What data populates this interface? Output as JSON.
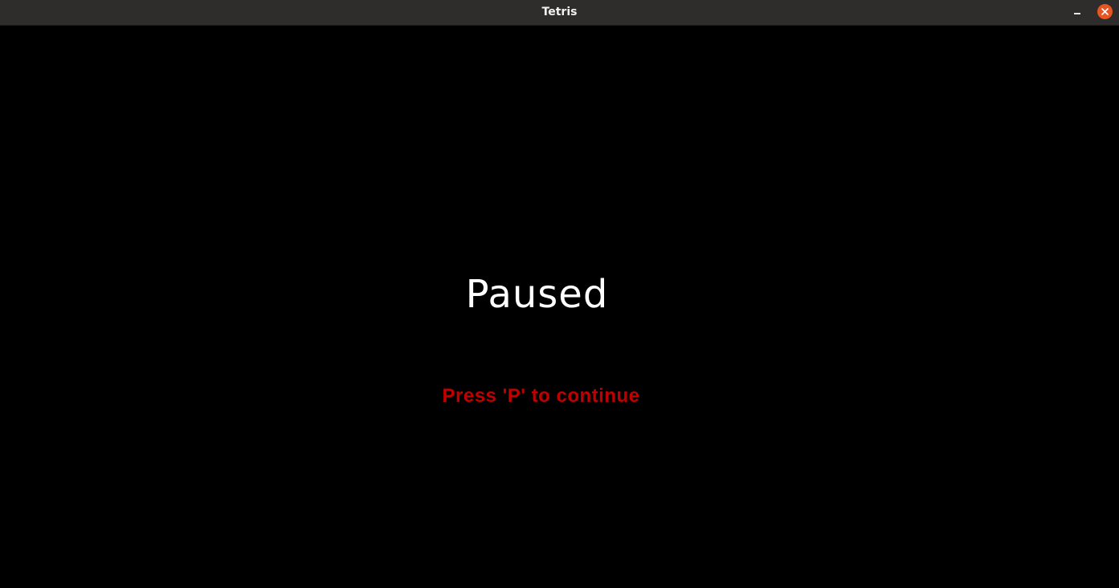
{
  "window": {
    "title": "Tetris",
    "controls": {
      "minimize_icon": "minimize-icon",
      "close_icon": "close-icon",
      "close_color": "#e95420"
    }
  },
  "game": {
    "state_title": "Paused",
    "hint": "Press 'P' to continue",
    "colors": {
      "background": "#000000",
      "title": "#ffffff",
      "hint": "#c00000"
    }
  }
}
